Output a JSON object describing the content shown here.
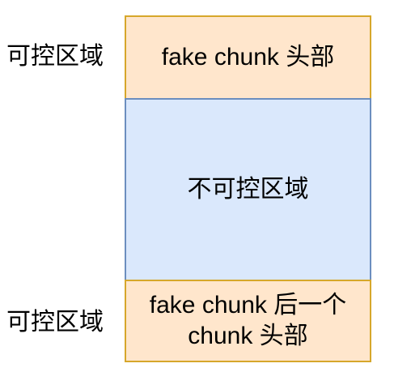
{
  "diagram": {
    "left_labels": {
      "top": "可控区域",
      "bottom": "可控区域"
    },
    "blocks": {
      "top": {
        "text": "fake chunk 头部",
        "color": "#ffe6cc"
      },
      "middle": {
        "text": "不可控区域",
        "color": "#dae8fc"
      },
      "bottom": {
        "text": "fake chunk 后一个\nchunk 头部",
        "color": "#ffe6cc"
      }
    },
    "border_colors": {
      "orange": "#d6a72b",
      "blue": "#6c8ebf"
    }
  }
}
